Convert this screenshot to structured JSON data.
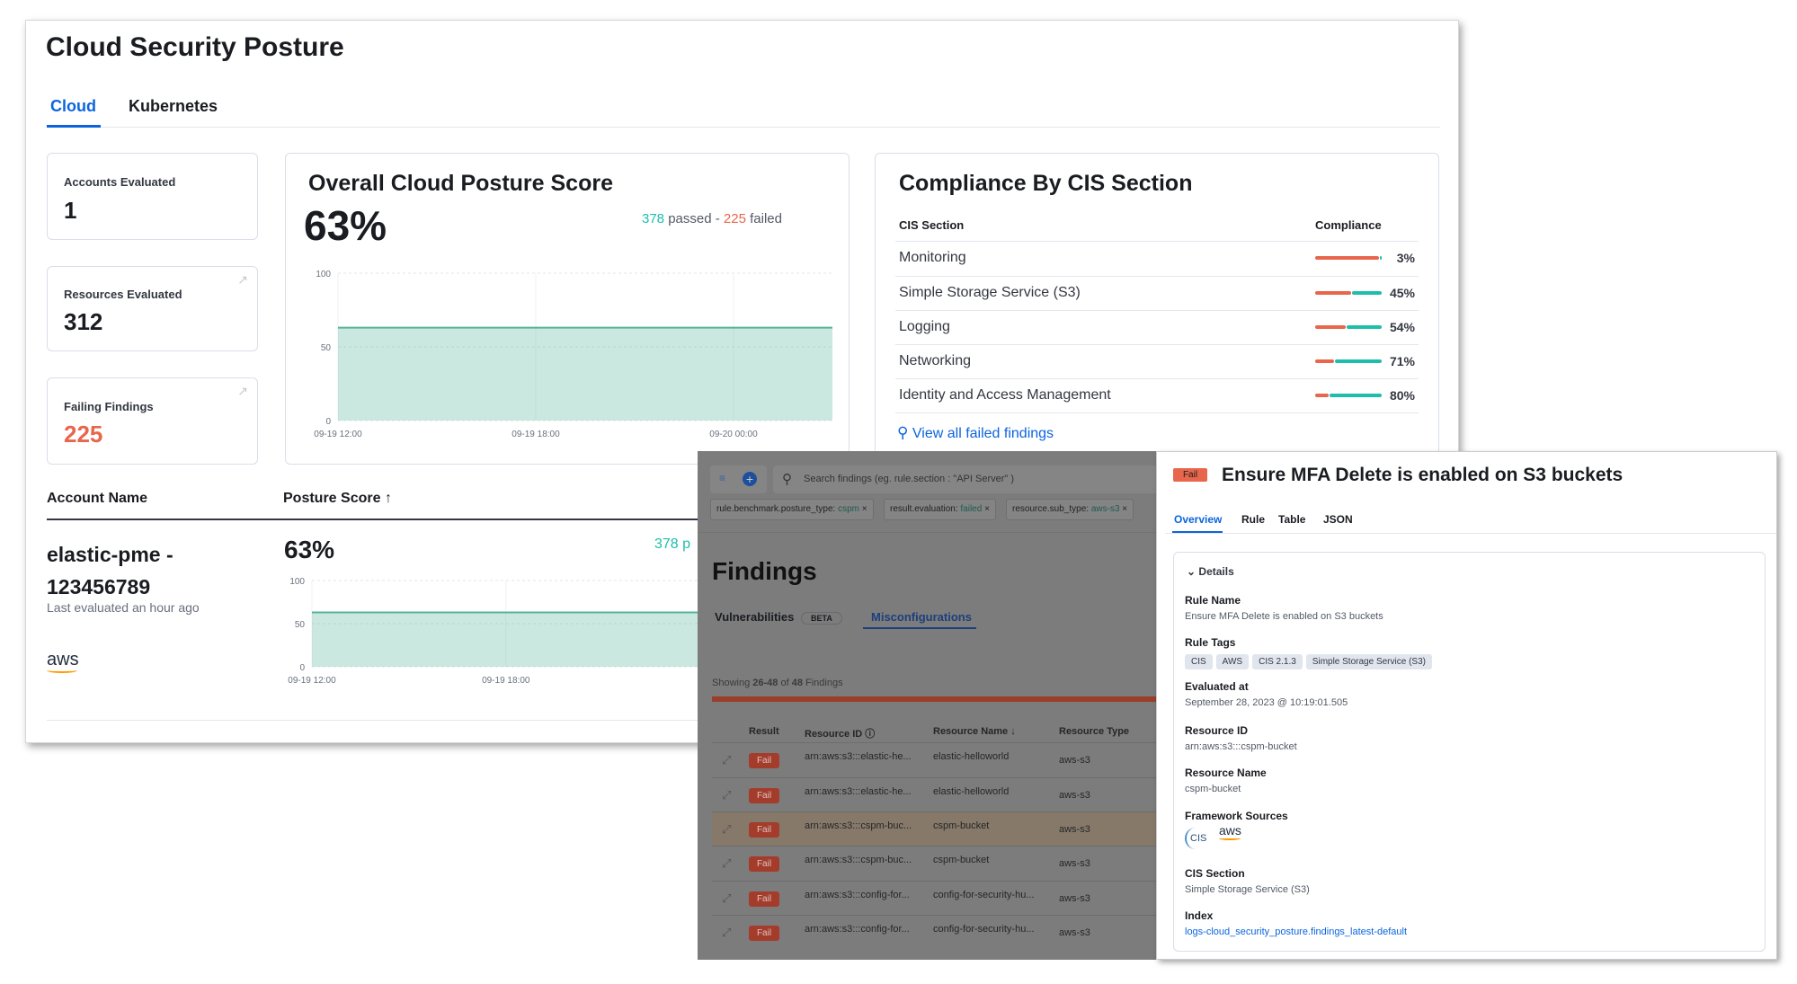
{
  "page": {
    "title": "Cloud Security Posture",
    "tabs": [
      "Cloud",
      "Kubernetes"
    ],
    "active_tab": "Cloud"
  },
  "stats": [
    {
      "label": "Accounts Evaluated",
      "value": "1"
    },
    {
      "label": "Resources Evaluated",
      "value": "312"
    },
    {
      "label": "Failing Findings",
      "value": "225"
    }
  ],
  "posture": {
    "title": "Overall Cloud Posture Score",
    "score": "63%",
    "passed": "378",
    "passed_label": "passed",
    "sep": "-",
    "failed": "225",
    "failed_label": "failed"
  },
  "chart_data": [
    {
      "type": "area",
      "title": "",
      "x": [
        "09-19 12:00",
        "09-19 18:00",
        "09-20 00:00",
        "09-20 03:00"
      ],
      "y": [
        63,
        63,
        63,
        63
      ],
      "yticks": [
        "0",
        "50",
        "100"
      ],
      "xticks": [
        "09-19 12:00",
        "09-19 18:00",
        "09-20 00:00"
      ],
      "ylim": [
        0,
        100
      ],
      "color": "#54b399",
      "grid": true
    },
    {
      "type": "area",
      "title": "",
      "x": [
        "09-19 12:00",
        "09-19 18:00",
        "09-20 00:00"
      ],
      "y": [
        63,
        63,
        63
      ],
      "yticks": [
        "0",
        "50",
        "100"
      ],
      "xticks": [
        "09-19 12:00",
        "09-19 18:00"
      ],
      "ylim": [
        0,
        100
      ],
      "color": "#54b399",
      "grid": true
    }
  ],
  "compliance": {
    "title": "Compliance By CIS Section",
    "col_section": "CIS Section",
    "col_compliance": "Compliance",
    "rows": [
      {
        "name": "Monitoring",
        "pct": 3,
        "label": "3%"
      },
      {
        "name": "Simple Storage Service (S3)",
        "pct": 45,
        "label": "45%"
      },
      {
        "name": "Logging",
        "pct": 54,
        "label": "54%"
      },
      {
        "name": "Networking",
        "pct": 71,
        "label": "71%"
      },
      {
        "name": "Identity and Access Management",
        "pct": 80,
        "label": "80%"
      }
    ],
    "link": "View all failed findings",
    "pass_color": "#1ebeab",
    "fail_color": "#e7664c"
  },
  "accounts": {
    "col_name": "Account Name",
    "col_score": "Posture Score",
    "name_line1": "elastic-pme -",
    "name_line2": "123456789",
    "last_eval": "Last evaluated an hour ago",
    "provider": "aws",
    "score": "63%",
    "passed_partial": "378 p"
  },
  "findings": {
    "search_placeholder": "Search findings (eg. rule.section : \"API Server\" )",
    "filters": [
      {
        "key": "rule.benchmark.posture_type: ",
        "val": "cspm"
      },
      {
        "key": "result.evaluation: ",
        "val": "failed"
      },
      {
        "key": "resource.sub_type: ",
        "val": "aws-s3"
      }
    ],
    "title": "Findings",
    "tab_vuln": "Vulnerabilities",
    "beta": "BETA",
    "tab_misconf": "Misconfigurations",
    "showing_prefix": "Showing ",
    "showing_range": "26-48",
    "showing_of": " of ",
    "showing_total": "48",
    "showing_suffix": " Findings",
    "columns": [
      "Result",
      "Resource ID",
      "Resource Name",
      "Resource Type"
    ],
    "rows": [
      {
        "result": "Fail",
        "id": "arn:aws:s3:::elastic-he...",
        "name": "elastic-helloworld",
        "type": "aws-s3"
      },
      {
        "result": "Fail",
        "id": "arn:aws:s3:::elastic-he...",
        "name": "elastic-helloworld",
        "type": "aws-s3"
      },
      {
        "result": "Fail",
        "id": "arn:aws:s3:::cspm-buc...",
        "name": "cspm-bucket",
        "type": "aws-s3"
      },
      {
        "result": "Fail",
        "id": "arn:aws:s3:::cspm-buc...",
        "name": "cspm-bucket",
        "type": "aws-s3"
      },
      {
        "result": "Fail",
        "id": "arn:aws:s3:::config-for...",
        "name": "config-for-security-hu...",
        "type": "aws-s3"
      },
      {
        "result": "Fail",
        "id": "arn:aws:s3:::config-for...",
        "name": "config-for-security-hu...",
        "type": "aws-s3"
      }
    ]
  },
  "flyout": {
    "badge": "Fail",
    "title": "Ensure MFA Delete is enabled on S3 buckets",
    "tabs": [
      "Overview",
      "Rule",
      "Table",
      "JSON"
    ],
    "details": "Details",
    "rule_name_label": "Rule Name",
    "rule_name": "Ensure MFA Delete is enabled on S3 buckets",
    "tags_label": "Rule Tags",
    "tags": [
      "CIS",
      "AWS",
      "CIS 2.1.3",
      "Simple Storage Service (S3)"
    ],
    "evaluated_label": "Evaluated at",
    "evaluated": "September 28, 2023 @ 10:19:01.505",
    "resource_id_label": "Resource ID",
    "resource_id": "arn:aws:s3:::cspm-bucket",
    "resource_name_label": "Resource Name",
    "resource_name": "cspm-bucket",
    "framework_label": "Framework Sources",
    "frameworks": [
      "CIS",
      "aws"
    ],
    "cis_section_label": "CIS Section",
    "cis_section": "Simple Storage Service (S3)",
    "index_label": "Index",
    "index": "logs-cloud_security_posture.findings_latest-default"
  }
}
